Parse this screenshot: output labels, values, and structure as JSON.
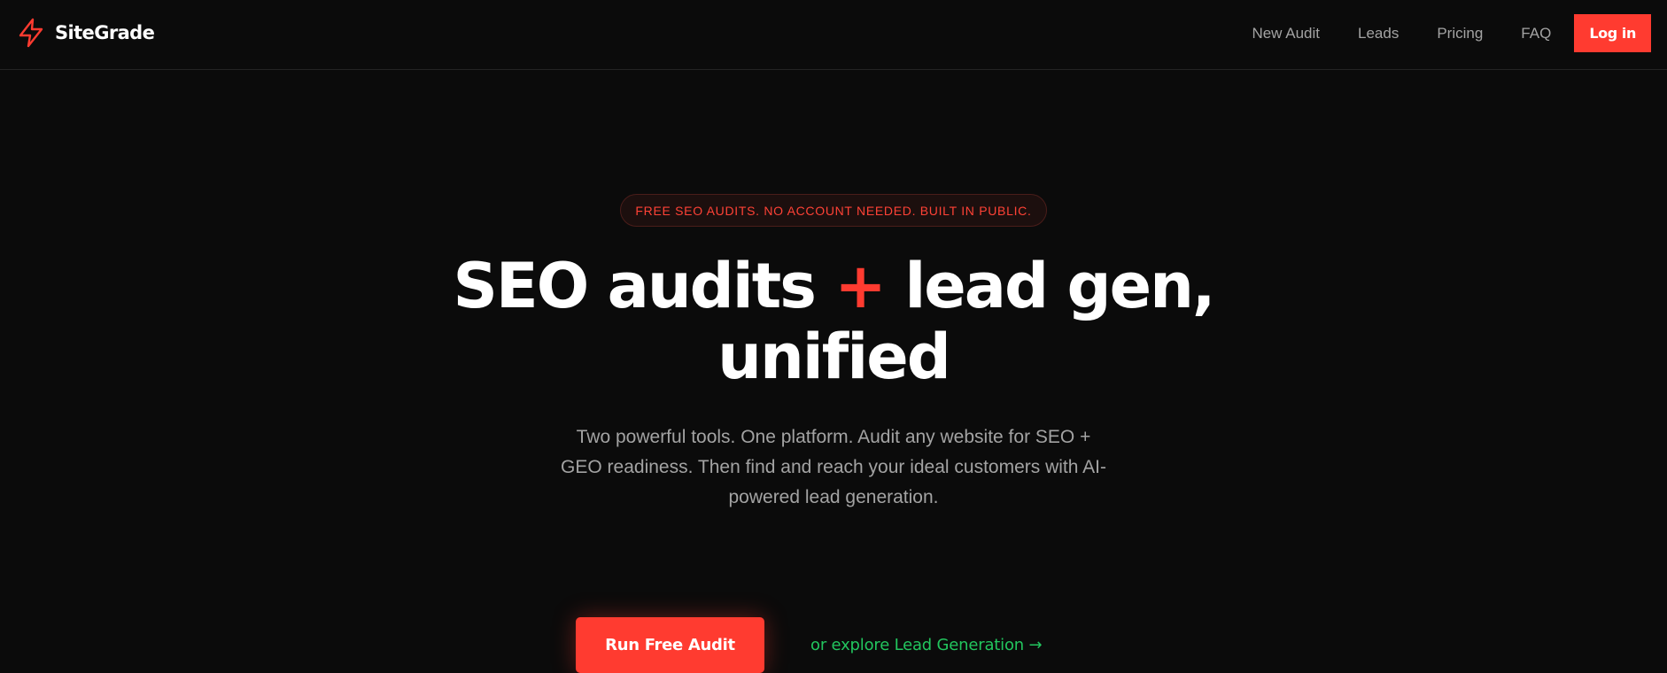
{
  "header": {
    "brand_name": "SiteGrade",
    "brand_icon": "lightning-bolt-icon",
    "nav": [
      {
        "label": "New Audit"
      },
      {
        "label": "Leads"
      },
      {
        "label": "Pricing"
      },
      {
        "label": "FAQ"
      }
    ],
    "login_label": "Log in"
  },
  "hero": {
    "badge": "FREE SEO AUDITS. NO ACCOUNT NEEDED. BUILT IN PUBLIC.",
    "headline_part1": "SEO audits",
    "headline_plus": "+",
    "headline_part2": "lead gen,",
    "headline_line2": "unified",
    "subtitle": "Two powerful tools. One platform. Audit any website for SEO + GEO readiness. Then find and reach your ideal customers with AI-powered lead generation.",
    "cta_primary": "Run Free Audit",
    "cta_secondary": "or explore Lead Generation →"
  },
  "colors": {
    "background": "#0b0b0b",
    "accent": "#ff3b30",
    "link_green": "#22c55e",
    "muted_text": "#a3a3a3"
  }
}
